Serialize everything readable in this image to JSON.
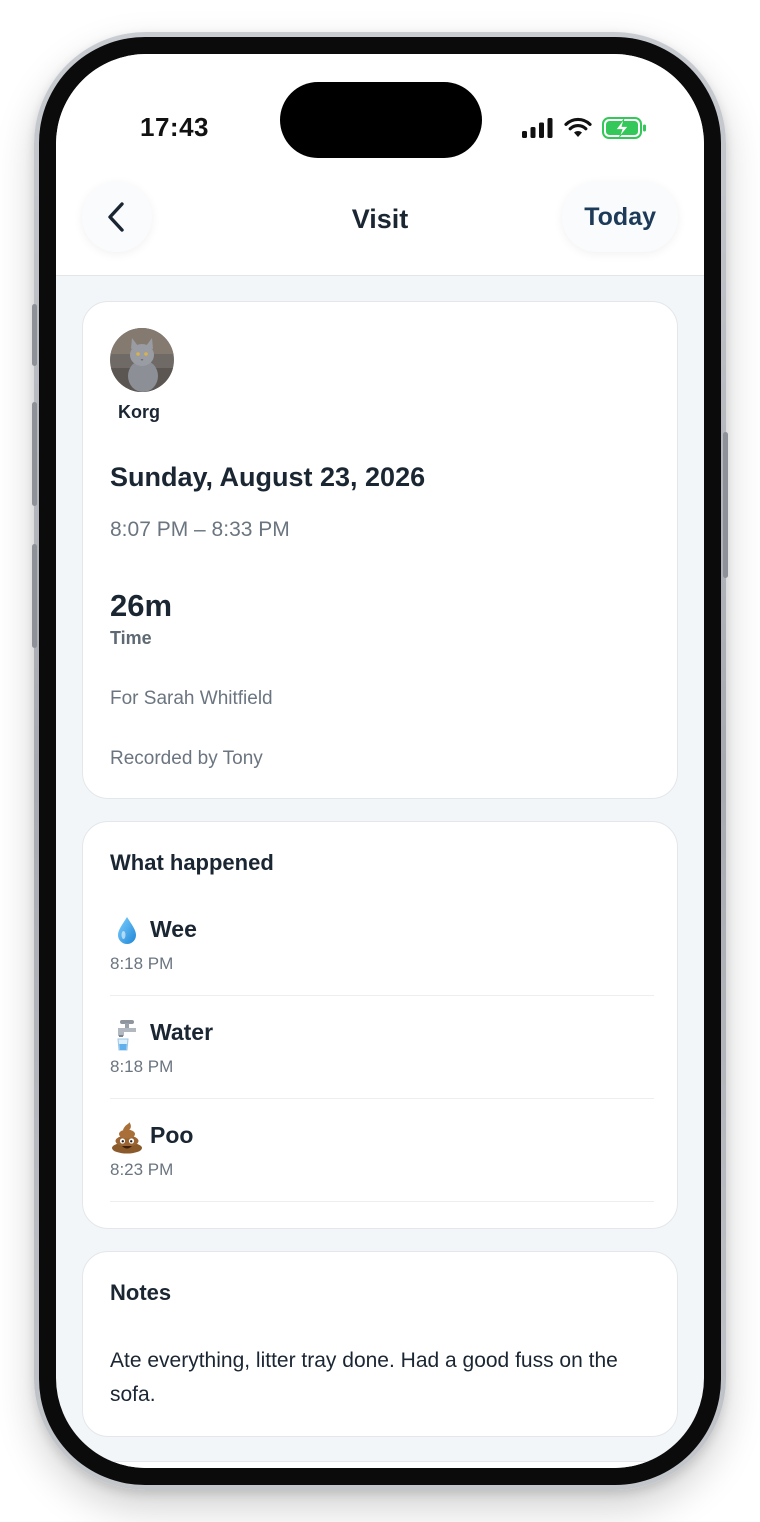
{
  "status_bar": {
    "time": "17:43"
  },
  "nav": {
    "back": "back",
    "title": "Visit",
    "today_label": "Today"
  },
  "visit": {
    "pet_name": "Korg",
    "date": "Sunday, August 23, 2026",
    "time_range": "8:07 PM – 8:33 PM",
    "duration": "26m",
    "duration_label": "Time",
    "client": "For Sarah Whitfield",
    "recorded_by": "Recorded by Tony"
  },
  "what_happened": {
    "title": "What happened",
    "events": [
      {
        "icon": "water-drop-icon",
        "name": "Wee",
        "time": "8:18 PM"
      },
      {
        "icon": "tap-water-icon",
        "name": "Water",
        "time": "8:18 PM"
      },
      {
        "icon": "poo-icon",
        "name": "Poo",
        "time": "8:23 PM"
      }
    ]
  },
  "notes": {
    "title": "Notes",
    "text": "Ate everything, litter tray done. Had a good fuss on the sofa."
  },
  "colors": {
    "primary_text": "#1b2633",
    "secondary_text": "#6b7580",
    "accent": "#1d3b58",
    "background": "#f3f6f8",
    "battery": "#34c759"
  }
}
